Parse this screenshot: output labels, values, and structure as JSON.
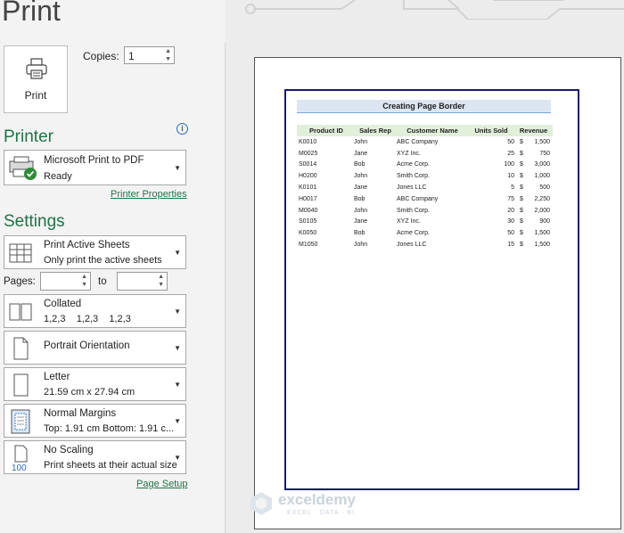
{
  "title": "Print",
  "print_button": {
    "label": "Print",
    "icon": "printer-icon"
  },
  "copies": {
    "label": "Copies:",
    "value": "1"
  },
  "printer_section": {
    "heading": "Printer",
    "name": "Microsoft Print to PDF",
    "status": "Ready",
    "properties_link": "Printer Properties"
  },
  "settings_section": {
    "heading": "Settings",
    "dropdowns": [
      {
        "line1": "Print Active Sheets",
        "line2": "Only print the active sheets",
        "icon": "sheets-icon"
      },
      {
        "line1": "Collated",
        "line2": "1,2,3    1,2,3    1,2,3",
        "icon": "collated-icon"
      },
      {
        "line1": "Portrait Orientation",
        "line2": "",
        "icon": "portrait-icon"
      },
      {
        "line1": "Letter",
        "line2": "21.59 cm x 27.94 cm",
        "icon": "paper-size-icon"
      },
      {
        "line1": "Normal Margins",
        "line2": "Top: 1.91 cm Bottom: 1.91 c...",
        "icon": "margins-icon"
      },
      {
        "line1": "No Scaling",
        "line2": "Print sheets at their actual size",
        "icon": "scaling-icon"
      }
    ],
    "pages_label": "Pages:",
    "to_label": "to",
    "page_setup_link": "Page Setup"
  },
  "preview": {
    "sheet_title": "Creating Page Border",
    "headers": [
      "Product ID",
      "Sales Rep",
      "Customer Name",
      "Units Sold",
      "Revenue"
    ],
    "rows": [
      [
        "K0010",
        "John",
        "ABC Company",
        "50",
        "$",
        "1,500"
      ],
      [
        "M0025",
        "Jane",
        "XYZ Inc.",
        "25",
        "$",
        "750"
      ],
      [
        "S0014",
        "Bob",
        "Acme Corp.",
        "100",
        "$",
        "3,000"
      ],
      [
        "H0200",
        "John",
        "Smith Corp.",
        "10",
        "$",
        "1,000"
      ],
      [
        "K0101",
        "Jane",
        "Jones LLC",
        "5",
        "$",
        "500"
      ],
      [
        "H0017",
        "Bob",
        "ABC Company",
        "75",
        "$",
        "2,250"
      ],
      [
        "M0040",
        "John",
        "Smith Corp.",
        "20",
        "$",
        "2,000"
      ],
      [
        "S0105",
        "Jane",
        "XYZ Inc.",
        "30",
        "$",
        "900"
      ],
      [
        "K0050",
        "Bob",
        "Acme Corp.",
        "50",
        "$",
        "1,500"
      ],
      [
        "M1050",
        "John",
        "Jones LLC",
        "15",
        "$",
        "1,500"
      ]
    ]
  },
  "watermark": {
    "name": "exceldemy",
    "tagline": "EXCEL · DATA · BI"
  },
  "colors": {
    "accent": "#217346",
    "border": "#1a1a6e",
    "header_fill": "#e2efda",
    "title_fill": "#dce6f2"
  }
}
